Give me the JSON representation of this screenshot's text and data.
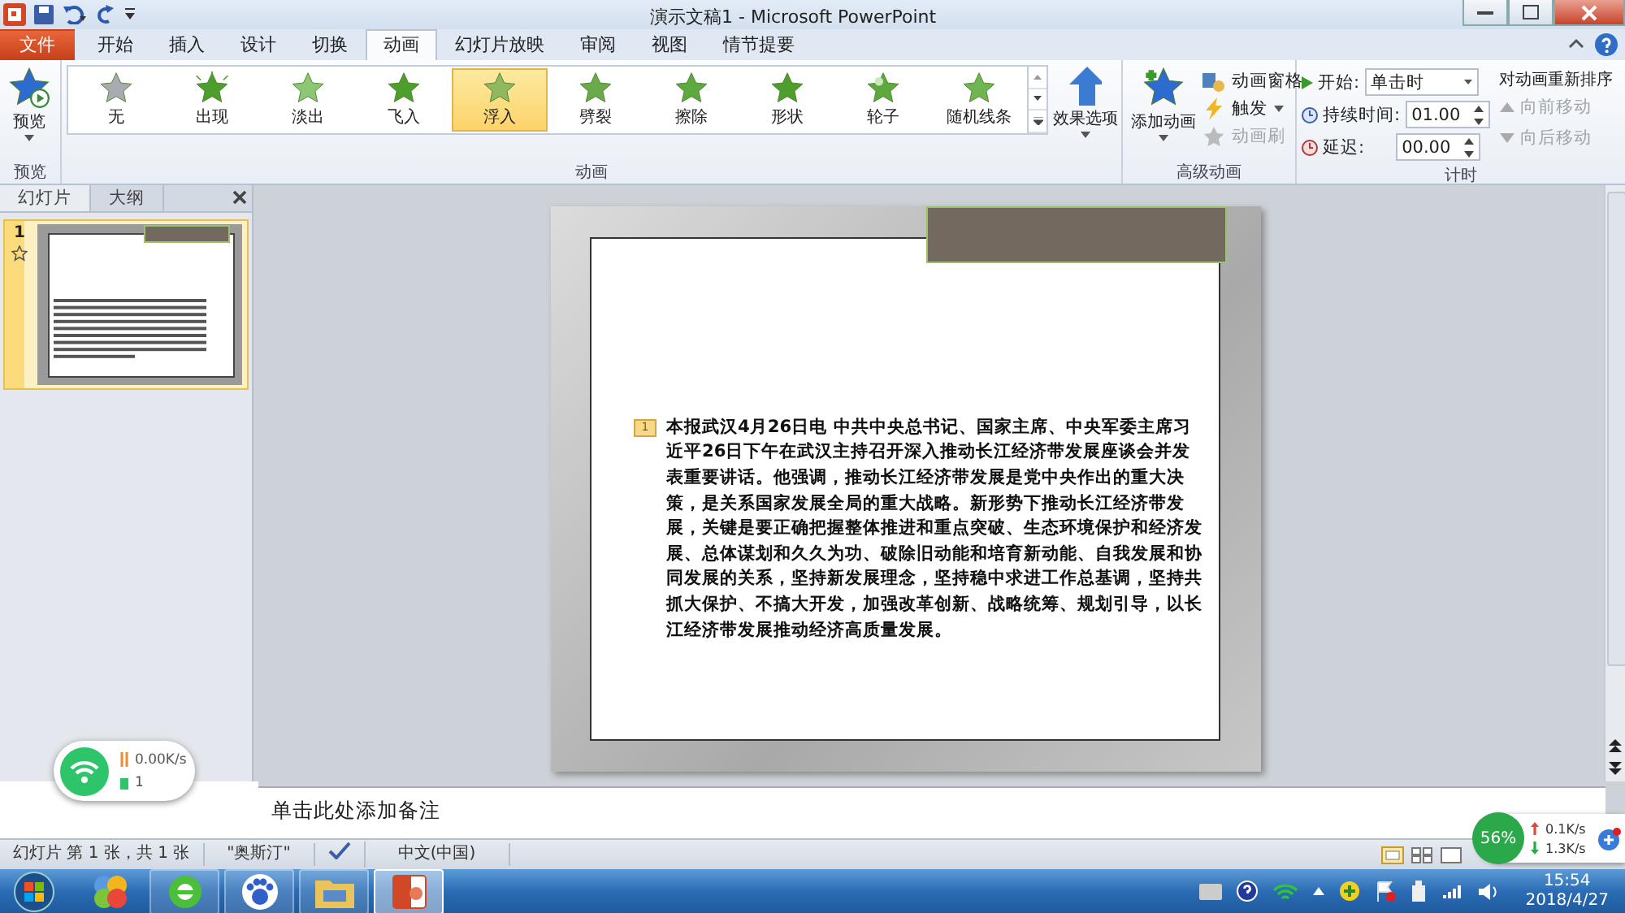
{
  "window": {
    "title": "演示文稿1 - Microsoft PowerPoint"
  },
  "ribbon_tabs": [
    {
      "label": "文件",
      "kind": "file",
      "selected": false
    },
    {
      "label": "开始",
      "kind": "tab",
      "selected": false
    },
    {
      "label": "插入",
      "kind": "tab",
      "selected": false
    },
    {
      "label": "设计",
      "kind": "tab",
      "selected": false
    },
    {
      "label": "切换",
      "kind": "tab",
      "selected": false
    },
    {
      "label": "动画",
      "kind": "tab",
      "selected": true
    },
    {
      "label": "幻灯片放映",
      "kind": "tab",
      "selected": false
    },
    {
      "label": "审阅",
      "kind": "tab",
      "selected": false
    },
    {
      "label": "视图",
      "kind": "tab",
      "selected": false
    },
    {
      "label": "情节提要",
      "kind": "tab",
      "selected": false
    }
  ],
  "preview": {
    "label": "预览",
    "group": "预览"
  },
  "animations": {
    "group": "动画",
    "effect_options": "效果选项",
    "items": [
      {
        "label": "无",
        "kind": "none",
        "selected": false
      },
      {
        "label": "出现",
        "kind": "appear",
        "selected": false
      },
      {
        "label": "淡出",
        "kind": "fade",
        "selected": false
      },
      {
        "label": "飞入",
        "kind": "fly",
        "selected": false
      },
      {
        "label": "浮入",
        "kind": "float",
        "selected": true
      },
      {
        "label": "劈裂",
        "kind": "split",
        "selected": false
      },
      {
        "label": "擦除",
        "kind": "wipe",
        "selected": false
      },
      {
        "label": "形状",
        "kind": "shape",
        "selected": false
      },
      {
        "label": "轮子",
        "kind": "wheel",
        "selected": false
      },
      {
        "label": "随机线条",
        "kind": "lines",
        "selected": false
      }
    ]
  },
  "advanced": {
    "group": "高级动画",
    "add": "添加动画",
    "buttons": [
      {
        "label": "动画窗格",
        "kind": "pane",
        "disabled": false
      },
      {
        "label": "触发",
        "kind": "trigger",
        "disabled": false
      },
      {
        "label": "动画刷",
        "kind": "painter",
        "disabled": true
      }
    ]
  },
  "timing": {
    "group": "计时",
    "start_label": "开始:",
    "start_value": "单击时",
    "duration_label": "持续时间:",
    "duration_value": "01.00",
    "delay_label": "延迟:",
    "delay_value": "00.00",
    "reorder": "对动画重新排序",
    "moves": [
      {
        "label": "向前移动",
        "kind": "up",
        "disabled": true
      },
      {
        "label": "向后移动",
        "kind": "down",
        "disabled": true
      }
    ]
  },
  "side_panel": {
    "tabs": [
      {
        "label": "幻灯片",
        "selected": true
      },
      {
        "label": "大纲",
        "selected": false
      }
    ],
    "slides": [
      {
        "number": "1",
        "selected": true
      }
    ]
  },
  "slide": {
    "marker": "1",
    "body": "本报武汉4月26日电 中共中央总书记、国家主席、中央军委主席习近平26日下午在武汉主持召开深入推动长江经济带发展座谈会并发表重要讲话。他强调，推动长江经济带发展是党中央作出的重大决策，是关系国家发展全局的重大战略。新形势下推动长江经济带发展，关键是要正确把握整体推进和重点突破、生态环境保护和经济发展、总体谋划和久久为功、破除旧动能和培育新动能、自我发展和协同发展的关系，坚持新发展理念，坚持稳中求进工作总基调，坚持共抓大保护、不搞大开发，加强改革创新、战略统筹、规划引导，以长江经济带发展推动经济高质量发展。"
  },
  "notes": {
    "placeholder": "单击此处添加备注"
  },
  "status_bar": {
    "slide_info": "幻灯片 第 1 张，共 1 张",
    "theme": "\"奥斯汀\"",
    "language": "中文(中国)"
  },
  "wifi_widget": {
    "speed": "0.00K/s",
    "devices": "1"
  },
  "net_widget": {
    "percent": "56%",
    "up": "0.1K/s",
    "down": "1.3K/s"
  },
  "taskbar": {
    "apps": [
      {
        "kind": "colorful",
        "selected": false
      },
      {
        "kind": "browser",
        "selected": false
      },
      {
        "kind": "paw",
        "selected": false
      },
      {
        "kind": "folder",
        "selected": false
      },
      {
        "kind": "ppt",
        "selected": true
      }
    ],
    "time": "15:54",
    "date": "2018/4/27"
  }
}
